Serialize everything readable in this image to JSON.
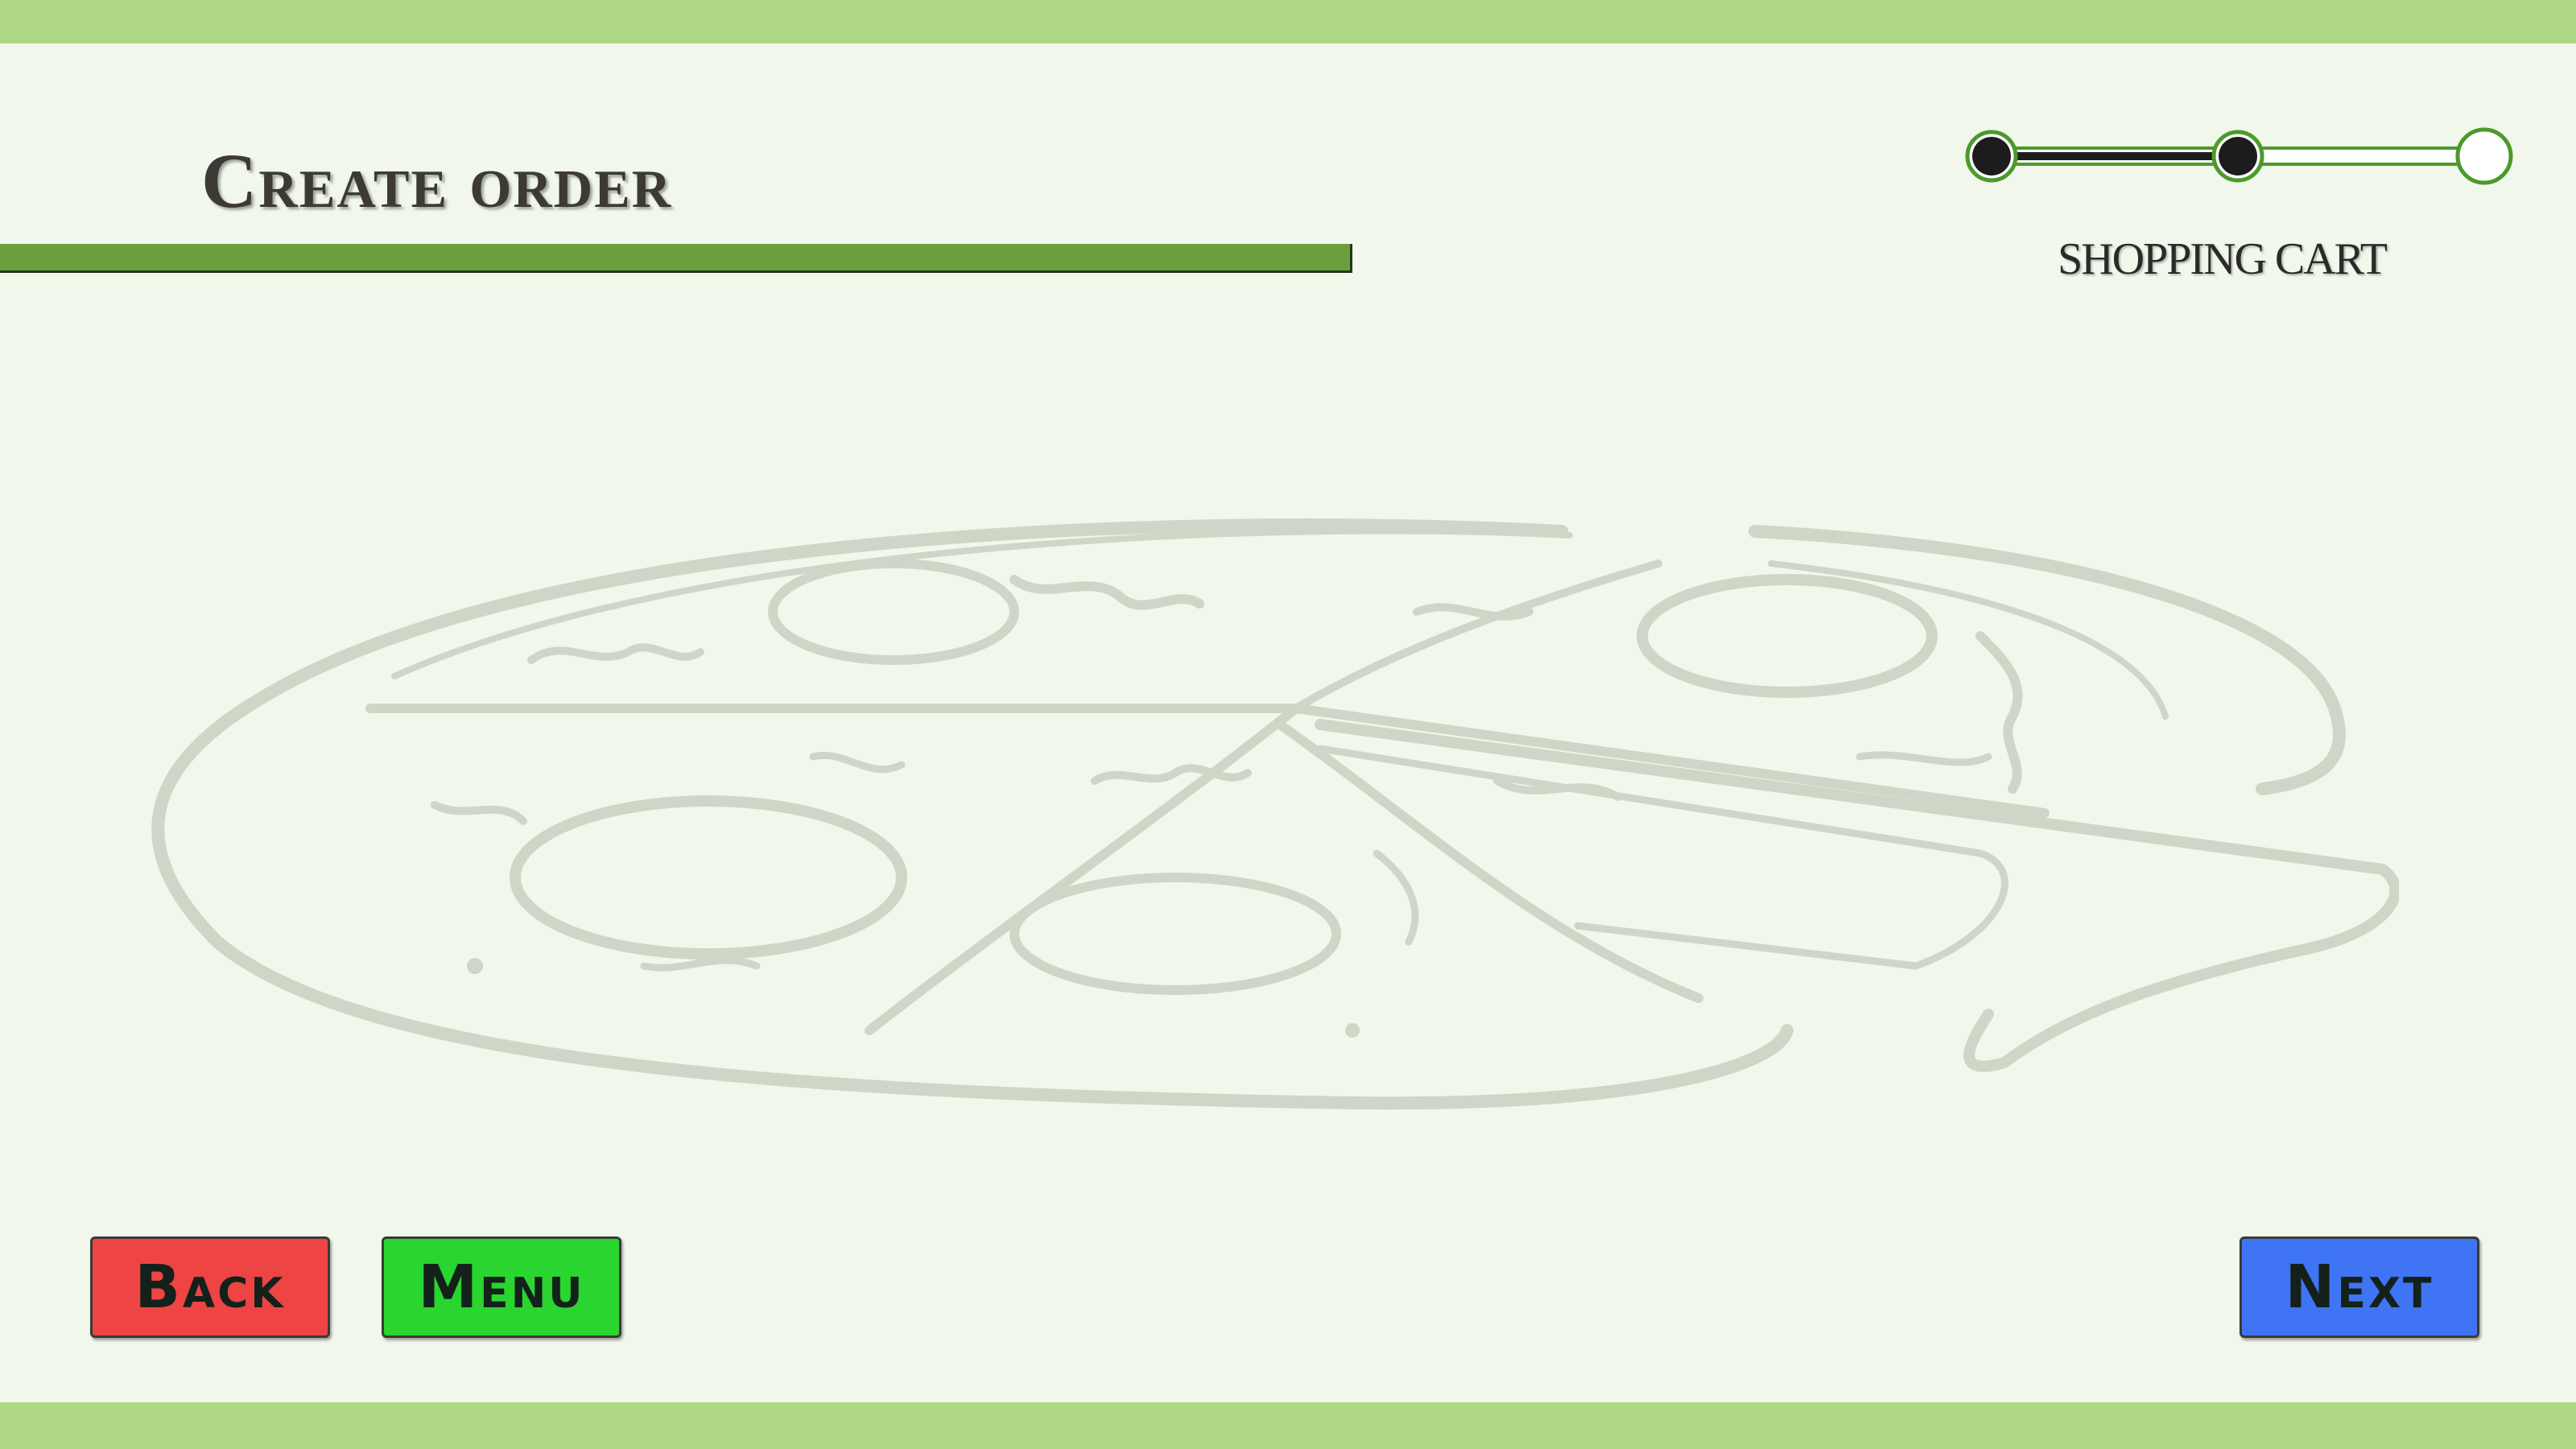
{
  "header": {
    "title": "Create order"
  },
  "progress": {
    "steps_total": 3,
    "steps_completed": 2,
    "current_step_label": "SHOPPING CART"
  },
  "illustration": {
    "name": "pizza-sketch"
  },
  "footer": {
    "back_label": "Back",
    "menu_label": "Menu",
    "next_label": "Next"
  },
  "colors": {
    "background": "#f1f7ea",
    "band": "#b0d786",
    "accent_green": "#6b9f3b",
    "back_button": "#ee4444",
    "menu_button": "#29d52e",
    "next_button": "#3f74f4"
  }
}
